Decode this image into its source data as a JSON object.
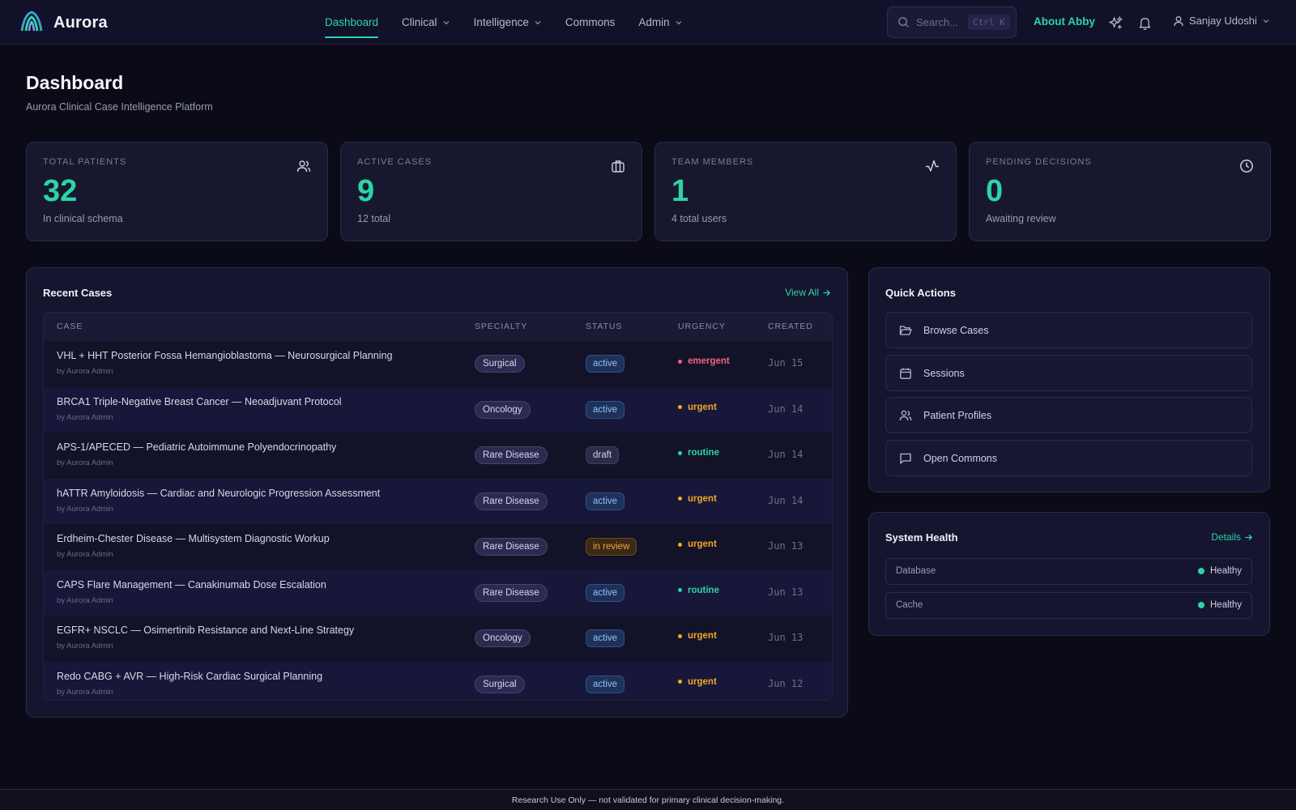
{
  "app": {
    "name": "Aurora",
    "logo_icon": "aurora-logo-icon"
  },
  "nav": {
    "items": [
      {
        "label": "Dashboard",
        "active": true,
        "dropdown": false
      },
      {
        "label": "Clinical",
        "active": false,
        "dropdown": true
      },
      {
        "label": "Intelligence",
        "active": false,
        "dropdown": true
      },
      {
        "label": "Commons",
        "active": false,
        "dropdown": false
      },
      {
        "label": "Admin",
        "active": false,
        "dropdown": true
      }
    ]
  },
  "search": {
    "placeholder": "Search...",
    "shortcut": "Ctrl K",
    "icon": "search-icon"
  },
  "header_actions": {
    "about_label": "About Abby",
    "sparkle_icon": "sparkles-icon",
    "bell_icon": "bell-icon",
    "user_name": "Sanjay Udoshi"
  },
  "page": {
    "title": "Dashboard",
    "subtitle": "Aurora Clinical Case Intelligence Platform"
  },
  "stats": [
    {
      "label": "TOTAL PATIENTS",
      "value": "32",
      "foot": "In clinical schema",
      "icon": "users-icon"
    },
    {
      "label": "ACTIVE CASES",
      "value": "9",
      "foot": "12 total",
      "icon": "briefcase-icon"
    },
    {
      "label": "TEAM MEMBERS",
      "value": "1",
      "foot": "4 total users",
      "icon": "activity-icon"
    },
    {
      "label": "PENDING DECISIONS",
      "value": "0",
      "foot": "Awaiting review",
      "icon": "clock-icon"
    }
  ],
  "recent_cases": {
    "title": "Recent Cases",
    "view_all": "View All",
    "columns": {
      "case": "CASE",
      "specialty": "SPECIALTY",
      "status": "STATUS",
      "urgency": "URGENCY",
      "created": "CREATED"
    },
    "rows": [
      {
        "title": "VHL + HHT Posterior Fossa Hemangioblastoma — Neurosurgical Planning",
        "by": "by Aurora Admin",
        "specialty": "Surgical",
        "status": "active",
        "urgency": "emergent",
        "created": "Jun 15"
      },
      {
        "title": "BRCA1 Triple-Negative Breast Cancer — Neoadjuvant Protocol",
        "by": "by Aurora Admin",
        "specialty": "Oncology",
        "status": "active",
        "urgency": "urgent",
        "created": "Jun 14"
      },
      {
        "title": "APS-1/APECED — Pediatric Autoimmune Polyendocrinopathy",
        "by": "by Aurora Admin",
        "specialty": "Rare Disease",
        "status": "draft",
        "urgency": "routine",
        "created": "Jun 14"
      },
      {
        "title": "hATTR Amyloidosis — Cardiac and Neurologic Progression Assessment",
        "by": "by Aurora Admin",
        "specialty": "Rare Disease",
        "status": "active",
        "urgency": "urgent",
        "created": "Jun 14"
      },
      {
        "title": "Erdheim-Chester Disease — Multisystem Diagnostic Workup",
        "by": "by Aurora Admin",
        "specialty": "Rare Disease",
        "status": "in review",
        "urgency": "urgent",
        "created": "Jun 13"
      },
      {
        "title": "CAPS Flare Management — Canakinumab Dose Escalation",
        "by": "by Aurora Admin",
        "specialty": "Rare Disease",
        "status": "active",
        "urgency": "routine",
        "created": "Jun 13"
      },
      {
        "title": "EGFR+ NSCLC — Osimertinib Resistance and Next-Line Strategy",
        "by": "by Aurora Admin",
        "specialty": "Oncology",
        "status": "active",
        "urgency": "urgent",
        "created": "Jun 13"
      },
      {
        "title": "Redo CABG + AVR — High-Risk Cardiac Surgical Planning",
        "by": "by Aurora Admin",
        "specialty": "Surgical",
        "status": "active",
        "urgency": "urgent",
        "created": "Jun 12"
      }
    ]
  },
  "urgency_colors": {
    "emergent": "#f0637e",
    "urgent": "#f5a623",
    "routine": "#2dd4a4"
  },
  "quick_actions": {
    "title": "Quick Actions",
    "items": [
      {
        "label": "Browse Cases",
        "icon": "folder-open-icon"
      },
      {
        "label": "Sessions",
        "icon": "calendar-icon"
      },
      {
        "label": "Patient Profiles",
        "icon": "users-icon"
      },
      {
        "label": "Open Commons",
        "icon": "message-square-icon"
      }
    ]
  },
  "system_health": {
    "title": "System Health",
    "details": "Details",
    "items": [
      {
        "name": "Database",
        "state": "Healthy"
      },
      {
        "name": "Cache",
        "state": "Healthy"
      }
    ]
  },
  "footer": {
    "text": "Research Use Only — not validated for primary clinical decision-making."
  },
  "colors": {
    "accent": "#2dd4a4",
    "background": "#0b0b17",
    "card": "#171730"
  }
}
